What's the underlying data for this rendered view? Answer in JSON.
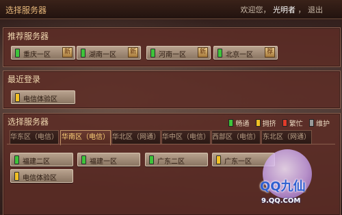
{
  "header": {
    "title": "选择服务器",
    "welcome": "欢迎您，",
    "username": "光明者",
    "logout": "退出"
  },
  "recommended": {
    "title": "推荐服务器",
    "servers": [
      {
        "name": "重庆一区",
        "status": "畅通",
        "tag": "新"
      },
      {
        "name": "湖南一区",
        "status": "畅通",
        "tag": "新"
      },
      {
        "name": "河南一区",
        "status": "畅通",
        "tag": "新"
      },
      {
        "name": "北京一区",
        "status": "畅通",
        "tag": "荐"
      }
    ]
  },
  "recent": {
    "title": "最近登录",
    "servers": [
      {
        "name": "电信体验区",
        "status": "拥挤"
      }
    ]
  },
  "select": {
    "title": "选择服务器",
    "legend": [
      {
        "label": "畅通",
        "color": "#3ec43a"
      },
      {
        "label": "拥挤",
        "color": "#f2c024"
      },
      {
        "label": "繁忙",
        "color": "#e23b2a"
      },
      {
        "label": "维护",
        "color": "#9a9a9a"
      }
    ],
    "tabs": [
      {
        "label": "华东区（电信）",
        "active": false
      },
      {
        "label": "华南区（电信）",
        "active": true
      },
      {
        "label": "华北区（网通）",
        "active": false
      },
      {
        "label": "华中区（电信）",
        "active": false
      },
      {
        "label": "西部区（电信）",
        "active": false
      },
      {
        "label": "东北区（网通）",
        "active": false
      }
    ],
    "servers": [
      {
        "name": "福建二区",
        "status": "畅通"
      },
      {
        "name": "福建一区",
        "status": "畅通"
      },
      {
        "name": "广东二区",
        "status": "畅通"
      },
      {
        "name": "广东一区",
        "status": "拥挤"
      },
      {
        "name": "电信体验区",
        "status": "拥挤"
      }
    ]
  },
  "logo": {
    "line1": "QQ九仙",
    "line2": "9.QQ.COM"
  },
  "colors": {
    "ok": "#3ec43a",
    "busy": "#f2c024"
  }
}
